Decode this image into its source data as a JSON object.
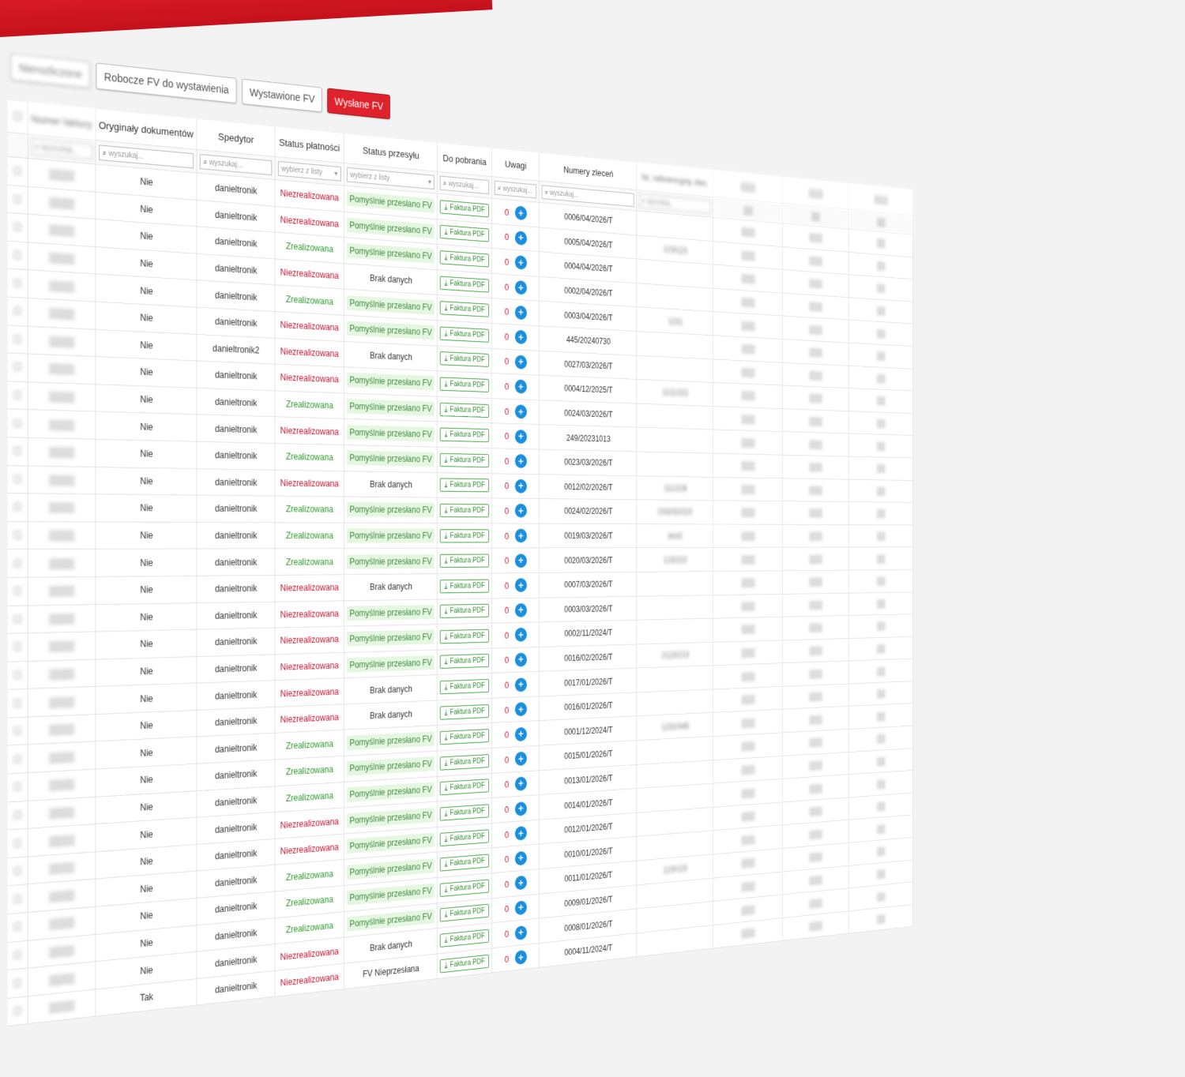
{
  "tabs": {
    "first": "Nierozliczone",
    "drafts": "Robocze FV do wystawienia",
    "issued": "Wystawione FV",
    "sent": "Wysłane FV"
  },
  "columns": {
    "invoice_nr": "Numer faktury",
    "originals": "Oryginały dokumentów",
    "carrier": "Spedytor",
    "payment": "Status płatności",
    "shipping": "Status przesyłu",
    "download": "Do pobrania",
    "notes": "Uwagi",
    "orders": "Numery zleceń",
    "ref": "Nr. referencyjny zlec."
  },
  "filters": {
    "search_ph": "wyszukaj...",
    "select_ph": "wybierz z listy"
  },
  "pdf_label": "Faktura PDF",
  "rows": [
    {
      "orig": "Nie",
      "sped": "danieltronik",
      "pay": "Niezrealizowana",
      "ship": "Pomyślnie przesłano FV",
      "cnt": "0",
      "ord": "0006/04/2026/T",
      "ref": "",
      "pay_ok": false,
      "ship_ok": true
    },
    {
      "orig": "Nie",
      "sped": "danieltronik",
      "pay": "Niezrealizowana",
      "ship": "Pomyślnie przesłano FV",
      "cnt": "0",
      "ord": "0005/04/2026/T",
      "ref": "123/123",
      "pay_ok": false,
      "ship_ok": true
    },
    {
      "orig": "Nie",
      "sped": "danieltronik",
      "pay": "Zrealizowana",
      "ship": "Pomyślnie przesłano FV",
      "cnt": "0",
      "ord": "0004/04/2026/T",
      "ref": "",
      "pay_ok": true,
      "ship_ok": true
    },
    {
      "orig": "Nie",
      "sped": "danieltronik",
      "pay": "Niezrealizowana",
      "ship": "Brak danych",
      "cnt": "0",
      "ord": "0002/04/2026/T",
      "ref": "",
      "pay_ok": false,
      "ship_ok": false
    },
    {
      "orig": "Nie",
      "sped": "danieltronik",
      "pay": "Zrealizowana",
      "ship": "Pomyślnie przesłano FV",
      "cnt": "0",
      "ord": "0003/04/2026/T",
      "ref": "1231",
      "pay_ok": true,
      "ship_ok": true
    },
    {
      "orig": "Nie",
      "sped": "danieltronik",
      "pay": "Niezrealizowana",
      "ship": "Pomyślnie przesłano FV",
      "cnt": "0",
      "ord": "445/20240730",
      "ref": "",
      "pay_ok": false,
      "ship_ok": true
    },
    {
      "orig": "Nie",
      "sped": "danieltronik2",
      "pay": "Niezrealizowana",
      "ship": "Brak danych",
      "cnt": "0",
      "ord": "0027/03/2026/T",
      "ref": "",
      "pay_ok": false,
      "ship_ok": false
    },
    {
      "orig": "Nie",
      "sped": "danieltronik",
      "pay": "Niezrealizowana",
      "ship": "Pomyślnie przesłano FV",
      "cnt": "0",
      "ord": "0004/12/2025/T",
      "ref": "1111/222",
      "pay_ok": false,
      "ship_ok": true
    },
    {
      "orig": "Nie",
      "sped": "danieltronik",
      "pay": "Zrealizowana",
      "ship": "Pomyślnie przesłano FV",
      "cnt": "0",
      "ord": "0024/03/2026/T",
      "ref": "",
      "pay_ok": true,
      "ship_ok": true
    },
    {
      "orig": "Nie",
      "sped": "danieltronik",
      "pay": "Niezrealizowana",
      "ship": "Pomyślnie przesłano FV",
      "cnt": "0",
      "ord": "249/20231013",
      "ref": "",
      "pay_ok": false,
      "ship_ok": true
    },
    {
      "orig": "Nie",
      "sped": "danieltronik",
      "pay": "Zrealizowana",
      "ship": "Pomyślnie przesłano FV",
      "cnt": "0",
      "ord": "0023/03/2026/T",
      "ref": "",
      "pay_ok": true,
      "ship_ok": true
    },
    {
      "orig": "Nie",
      "sped": "danieltronik",
      "pay": "Niezrealizowana",
      "ship": "Brak danych",
      "cnt": "0",
      "ord": "0012/02/2026/T",
      "ref": "111/228",
      "pay_ok": false,
      "ship_ok": false
    },
    {
      "orig": "Nie",
      "sped": "danieltronik",
      "pay": "Zrealizowana",
      "ship": "Pomyślnie przesłano FV",
      "cnt": "0",
      "ord": "0024/02/2026/T",
      "ref": "233232/222",
      "pay_ok": true,
      "ship_ok": true
    },
    {
      "orig": "Nie",
      "sped": "danieltronik",
      "pay": "Zrealizowana",
      "ship": "Pomyślnie przesłano FV",
      "cnt": "0",
      "ord": "0019/03/2026/T",
      "ref": "test2",
      "pay_ok": true,
      "ship_ok": true
    },
    {
      "orig": "Nie",
      "sped": "danieltronik",
      "pay": "Zrealizowana",
      "ship": "Pomyślnie przesłano FV",
      "cnt": "0",
      "ord": "0020/03/2026/T",
      "ref": "123/222",
      "pay_ok": true,
      "ship_ok": true
    },
    {
      "orig": "Nie",
      "sped": "danieltronik",
      "pay": "Niezrealizowana",
      "ship": "Brak danych",
      "cnt": "0",
      "ord": "0007/03/2026/T",
      "ref": "",
      "pay_ok": false,
      "ship_ok": false
    },
    {
      "orig": "Nie",
      "sped": "danieltronik",
      "pay": "Niezrealizowana",
      "ship": "Pomyślnie przesłano FV",
      "cnt": "0",
      "ord": "0003/03/2026/T",
      "ref": "",
      "pay_ok": false,
      "ship_ok": true
    },
    {
      "orig": "Nie",
      "sped": "danieltronik",
      "pay": "Niezrealizowana",
      "ship": "Pomyślnie przesłano FV",
      "cnt": "0",
      "ord": "0002/11/2024/T",
      "ref": "",
      "pay_ok": false,
      "ship_ok": true
    },
    {
      "orig": "Nie",
      "sped": "danieltronik",
      "pay": "Niezrealizowana",
      "ship": "Pomyślnie przesłano FV",
      "cnt": "0",
      "ord": "0016/02/2026/T",
      "ref": "2123/213",
      "pay_ok": false,
      "ship_ok": true
    },
    {
      "orig": "Nie",
      "sped": "danieltronik",
      "pay": "Niezrealizowana",
      "ship": "Brak danych",
      "cnt": "0",
      "ord": "0017/01/2026/T",
      "ref": "",
      "pay_ok": false,
      "ship_ok": false
    },
    {
      "orig": "Nie",
      "sped": "danieltronik",
      "pay": "Niezrealizowana",
      "ship": "Brak danych",
      "cnt": "0",
      "ord": "0016/01/2026/T",
      "ref": "",
      "pay_ok": false,
      "ship_ok": false
    },
    {
      "orig": "Nie",
      "sped": "danieltronik",
      "pay": "Zrealizowana",
      "ship": "Pomyślnie przesłano FV",
      "cnt": "0",
      "ord": "0001/12/2024/T",
      "ref": "1232/345",
      "pay_ok": true,
      "ship_ok": true
    },
    {
      "orig": "Nie",
      "sped": "danieltronik",
      "pay": "Zrealizowana",
      "ship": "Pomyślnie przesłano FV",
      "cnt": "0",
      "ord": "0015/01/2026/T",
      "ref": "",
      "pay_ok": true,
      "ship_ok": true
    },
    {
      "orig": "Nie",
      "sped": "danieltronik",
      "pay": "Zrealizowana",
      "ship": "Pomyślnie przesłano FV",
      "cnt": "0",
      "ord": "0013/01/2026/T",
      "ref": "",
      "pay_ok": true,
      "ship_ok": true
    },
    {
      "orig": "Nie",
      "sped": "danieltronik",
      "pay": "Niezrealizowana",
      "ship": "Pomyślnie przesłano FV",
      "cnt": "0",
      "ord": "0014/01/2026/T",
      "ref": "",
      "pay_ok": false,
      "ship_ok": true
    },
    {
      "orig": "Nie",
      "sped": "danieltronik",
      "pay": "Niezrealizowana",
      "ship": "Pomyślnie przesłano FV",
      "cnt": "0",
      "ord": "0012/01/2026/T",
      "ref": "",
      "pay_ok": false,
      "ship_ok": true
    },
    {
      "orig": "Nie",
      "sped": "danieltronik",
      "pay": "Zrealizowana",
      "ship": "Pomyślnie przesłano FV",
      "cnt": "0",
      "ord": "0010/01/2026/T",
      "ref": "",
      "pay_ok": true,
      "ship_ok": true
    },
    {
      "orig": "Nie",
      "sped": "danieltronik",
      "pay": "Zrealizowana",
      "ship": "Pomyślnie przesłano FV",
      "cnt": "0",
      "ord": "0011/01/2026/T",
      "ref": "123/123",
      "pay_ok": true,
      "ship_ok": true
    },
    {
      "orig": "Nie",
      "sped": "danieltronik",
      "pay": "Zrealizowana",
      "ship": "Pomyślnie przesłano FV",
      "cnt": "0",
      "ord": "0009/01/2026/T",
      "ref": "",
      "pay_ok": true,
      "ship_ok": true
    },
    {
      "orig": "Nie",
      "sped": "danieltronik",
      "pay": "Niezrealizowana",
      "ship": "Brak danych",
      "cnt": "0",
      "ord": "0008/01/2026/T",
      "ref": "",
      "pay_ok": false,
      "ship_ok": false
    },
    {
      "orig": "Tak",
      "sped": "danieltronik",
      "pay": "Niezrealizowana",
      "ship": "FV Nieprzesłana",
      "cnt": "0",
      "ord": "0004/11/2024/T",
      "ref": "",
      "pay_ok": false,
      "ship_ok": false
    }
  ]
}
